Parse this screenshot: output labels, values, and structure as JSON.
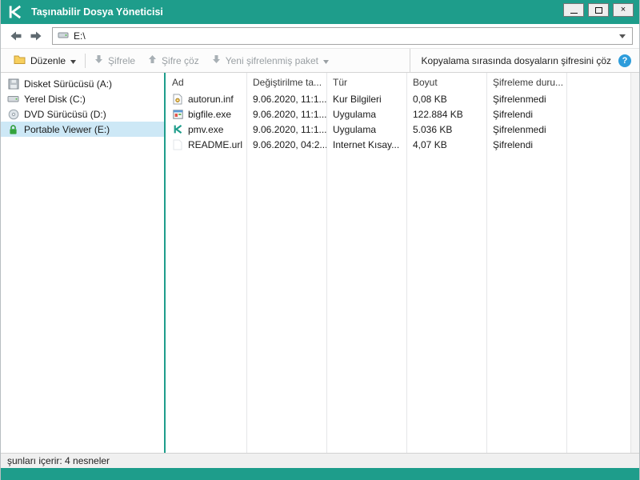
{
  "window": {
    "title": "Taşınabilir Dosya Yöneticisi",
    "controls": {
      "close_glyph": "×"
    }
  },
  "colors": {
    "accent_teal": "#1E9D8B",
    "selection_blue": "#CDE8F6",
    "help_blue": "#2D9CDB"
  },
  "nav": {
    "address": "E:\\"
  },
  "toolbar": {
    "edit_label": "Düzenle",
    "encrypt_label": "Şifrele",
    "decrypt_label": "Şifre çöz",
    "new_package_label": "Yeni şifrelenmiş paket",
    "decrypt_on_copy_label": "Kopyalama sırasında dosyaların şifresini çöz",
    "help_glyph": "?"
  },
  "sidebar": {
    "items": [
      {
        "label": "Disket Sürücüsü (A:)",
        "icon": "floppy-drive-icon",
        "selected": false
      },
      {
        "label": "Yerel Disk (C:)",
        "icon": "hard-drive-icon",
        "selected": false
      },
      {
        "label": "DVD Sürücüsü (D:)",
        "icon": "dvd-drive-icon",
        "selected": false
      },
      {
        "label": "Portable Viewer (E:)",
        "icon": "encrypted-drive-lock-icon",
        "selected": true
      }
    ]
  },
  "file_list": {
    "columns": [
      {
        "label": "Ad"
      },
      {
        "label": "Değiştirilme ta..."
      },
      {
        "label": "Tür"
      },
      {
        "label": "Boyut"
      },
      {
        "label": "Şifreleme duru..."
      }
    ],
    "rows": [
      {
        "name": "autorun.inf",
        "modified": "9.06.2020, 11:1...",
        "type": "Kur Bilgileri",
        "size": "0,08 KB",
        "encryption_status": "Şifrelenmedi",
        "icon": "setup-information-file-icon"
      },
      {
        "name": "bigfile.exe",
        "modified": "9.06.2020, 11:1...",
        "type": "Uygulama",
        "size": "122.884 KB",
        "encryption_status": "Şifrelendi",
        "icon": "application-file-icon"
      },
      {
        "name": "pmv.exe",
        "modified": "9.06.2020, 11:1...",
        "type": "Uygulama",
        "size": "5.036 KB",
        "encryption_status": "Şifrelenmedi",
        "icon": "kaspersky-app-icon"
      },
      {
        "name": "README.url",
        "modified": "9.06.2020, 04:2...",
        "type": "Internet Kısay...",
        "size": "4,07 KB",
        "encryption_status": "Şifrelendi",
        "icon": "url-file-icon"
      }
    ]
  },
  "status_bar": {
    "text": "şunları içerir: 4 nesneler"
  }
}
